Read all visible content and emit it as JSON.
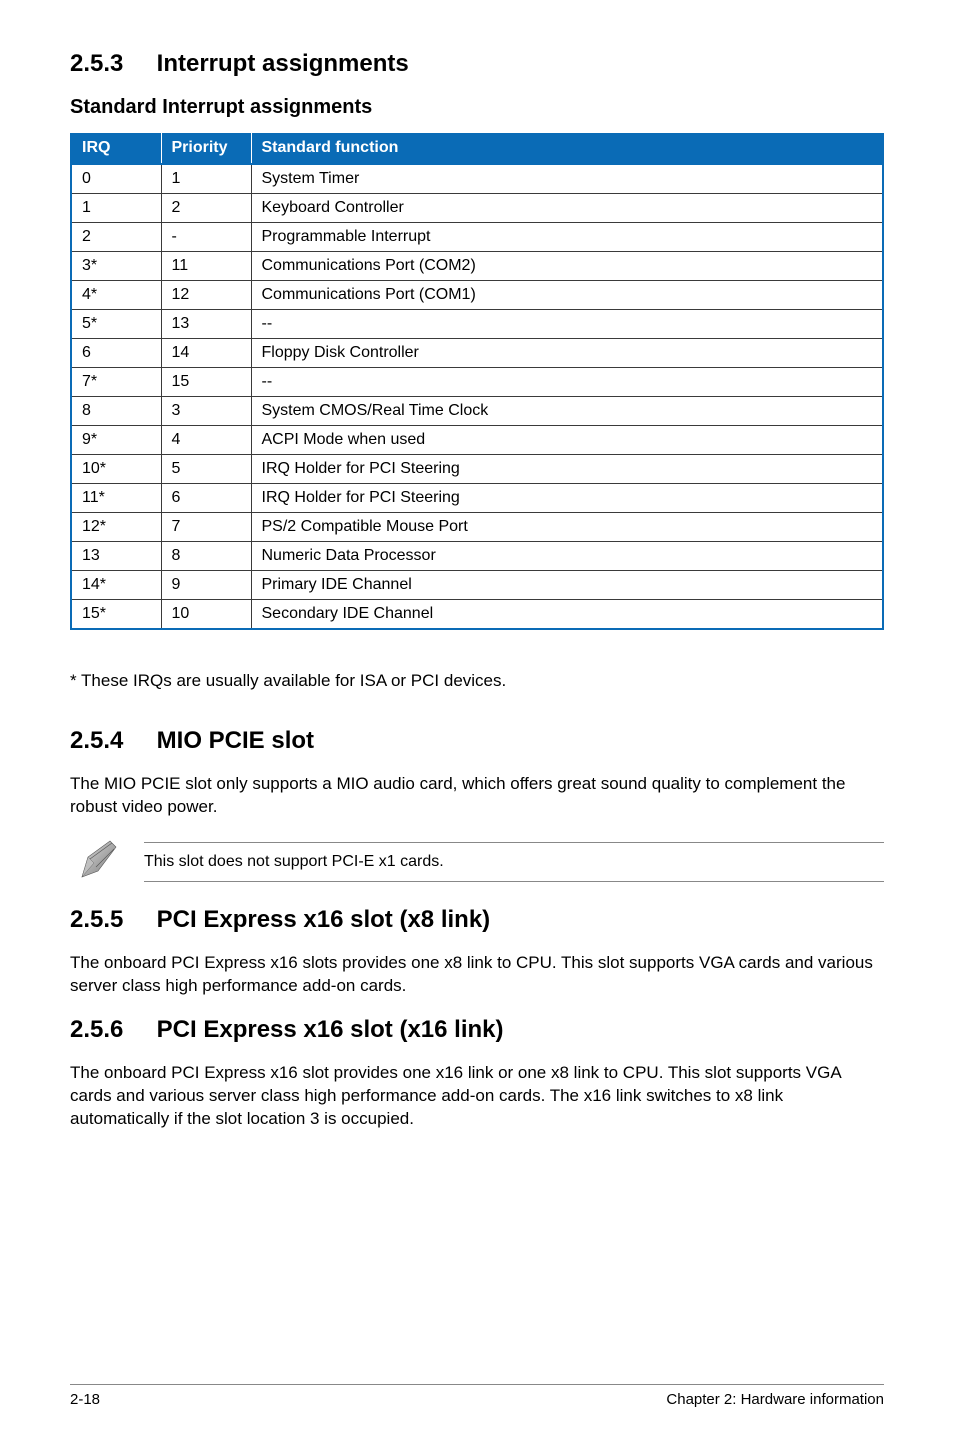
{
  "sections": {
    "s253": {
      "num": "2.5.3",
      "title": "Interrupt assignments"
    },
    "s254": {
      "num": "2.5.4",
      "title": "MIO PCIE slot"
    },
    "s255": {
      "num": "2.5.5",
      "title": "PCI Express x16 slot (x8 link)"
    },
    "s256": {
      "num": "2.5.6",
      "title": "PCI Express x16 slot (x16 link)"
    }
  },
  "subheading_std": "Standard Interrupt assignments",
  "table_headers": {
    "irq": "IRQ",
    "priority": "Priority",
    "func": "Standard function"
  },
  "table_rows": [
    {
      "irq": "0",
      "priority": "1",
      "func": "System Timer"
    },
    {
      "irq": "1",
      "priority": "2",
      "func": "Keyboard Controller"
    },
    {
      "irq": "2",
      "priority": "-",
      "func": "Programmable Interrupt"
    },
    {
      "irq": "3*",
      "priority": "11",
      "func": "Communications Port (COM2)"
    },
    {
      "irq": "4*",
      "priority": "12",
      "func": "Communications Port (COM1)"
    },
    {
      "irq": "5*",
      "priority": "13",
      "func": "--"
    },
    {
      "irq": "6",
      "priority": "14",
      "func": "Floppy Disk Controller"
    },
    {
      "irq": "7*",
      "priority": "15",
      "func": "--"
    },
    {
      "irq": "8",
      "priority": "3",
      "func": "System CMOS/Real Time Clock"
    },
    {
      "irq": "9*",
      "priority": "4",
      "func": "ACPI Mode when used"
    },
    {
      "irq": "10*",
      "priority": "5",
      "func": "IRQ Holder for PCI Steering"
    },
    {
      "irq": "11*",
      "priority": "6",
      "func": "IRQ Holder for PCI Steering"
    },
    {
      "irq": "12*",
      "priority": "7",
      "func": "PS/2 Compatible Mouse Port"
    },
    {
      "irq": "13",
      "priority": "8",
      "func": "Numeric Data Processor"
    },
    {
      "irq": "14*",
      "priority": "9",
      "func": "Primary IDE Channel"
    },
    {
      "irq": "15*",
      "priority": "10",
      "func": "Secondary IDE Channel"
    }
  ],
  "footnote": "* These IRQs are usually available for ISA or PCI devices.",
  "p_254": "The MIO PCIE slot only supports a MIO audio card, which offers great sound quality to complement the robust video power.",
  "note_254": "This slot does not support PCI-E x1 cards.",
  "p_255": "The onboard PCI Express x16 slots provides one x8 link to CPU. This slot supports VGA cards and various server class high performance add-on cards.",
  "p_256": "The onboard PCI Express x16 slot provides one x16 link or one x8 link to CPU. This slot supports VGA cards and various server class high performance add-on cards. The x16 link switches to x8 link automatically if the slot location 3 is occupied.",
  "footer": {
    "left": "2-18",
    "right": "Chapter 2: Hardware information"
  }
}
